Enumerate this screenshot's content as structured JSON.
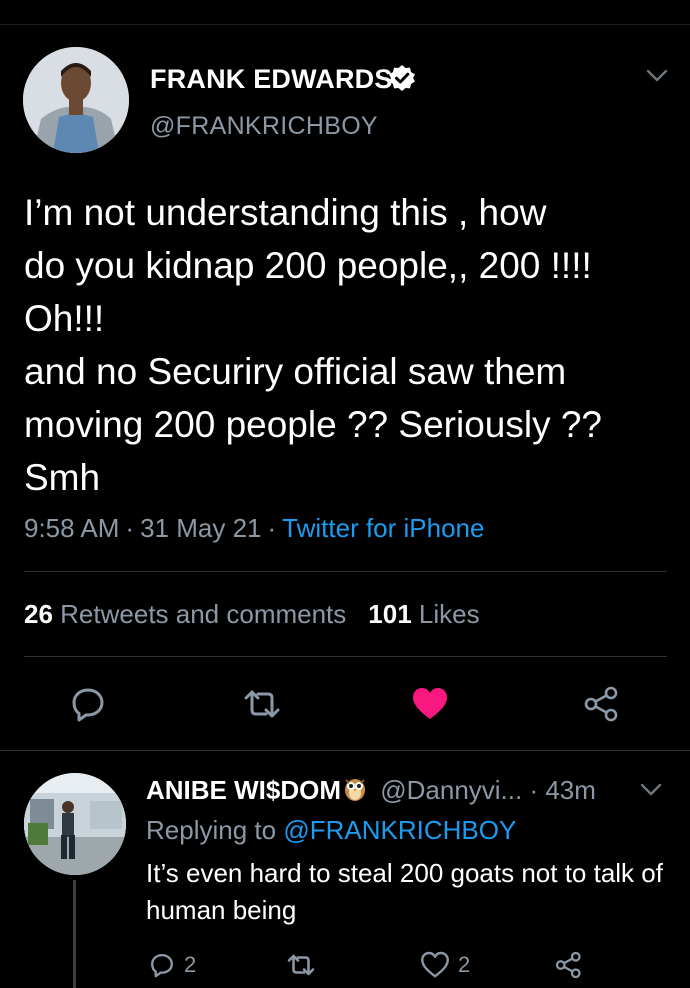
{
  "tweet": {
    "author_name": "FRANK EDWARDS",
    "handle": "@FRANKRICHBOY",
    "text": "I’m not understanding this , how\ndo you kidnap 200 people,, 200 !!!!\nOh!!!\nand no Securiry official saw them\nmoving 200 people ?? Seriously ??\nSmh",
    "time": "9:58 AM",
    "date": "31 May 21",
    "source": "Twitter for iPhone",
    "separator": "·",
    "retweets_count": "26",
    "retweets_label": "Retweets and comments",
    "likes_count": "101",
    "likes_label": "Likes",
    "liked": true
  },
  "reply": {
    "author_name": "ANIBE WI$DOM",
    "handle": "@Dannyvi...",
    "time": "· 43m",
    "replying_prefix": "Replying to",
    "replying_to": "@FRANKRICHBOY",
    "text": "It’s even hard to steal 200 goats not to talk of human being",
    "reply_count": "2",
    "like_count": "2"
  },
  "colors": {
    "background": "#000000",
    "text": "#ffffff",
    "secondary": "#8b98a5",
    "link": "#1d9bf0",
    "like": "#f91880",
    "divider": "#2f3336"
  },
  "icons": [
    "verified-badge-icon",
    "chevron-down-icon",
    "reply-icon",
    "retweet-icon",
    "heart-icon",
    "share-icon",
    "owl-emoji-icon"
  ]
}
